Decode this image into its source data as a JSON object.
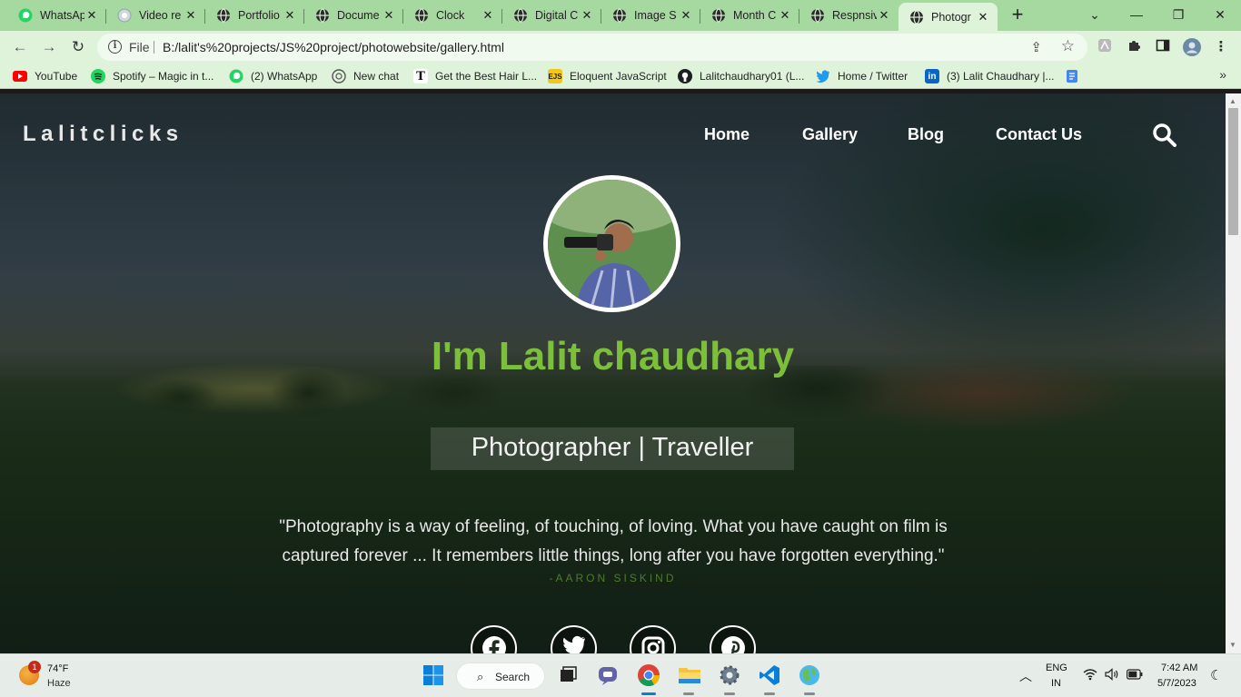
{
  "browser": {
    "tabs": [
      {
        "label": "WhatsApp",
        "favicon": "whatsapp-icon"
      },
      {
        "label": "Video re",
        "favicon": "video-icon"
      },
      {
        "label": "Portfolio",
        "favicon": "globe-icon"
      },
      {
        "label": "Docume",
        "favicon": "globe-icon"
      },
      {
        "label": "Clock",
        "favicon": "globe-icon"
      },
      {
        "label": "Digital C",
        "favicon": "globe-icon"
      },
      {
        "label": "Image S",
        "favicon": "globe-icon"
      },
      {
        "label": "Month C",
        "favicon": "globe-icon"
      },
      {
        "label": "Respnsiv",
        "favicon": "globe-icon"
      },
      {
        "label": "Photogr",
        "favicon": "globe-icon",
        "active": true
      }
    ],
    "address": {
      "scheme_label": "File",
      "url": "B:/lalit's%20projects/JS%20project/photowebsite/gallery.html"
    },
    "bookmarks": [
      {
        "label": "YouTube",
        "icon": "youtube-icon"
      },
      {
        "label": "Spotify – Magic in t...",
        "icon": "spotify-icon"
      },
      {
        "label": "(2) WhatsApp",
        "icon": "whatsapp-icon"
      },
      {
        "label": "New chat",
        "icon": "openai-icon"
      },
      {
        "label": "Get the Best Hair L...",
        "icon": "t-icon"
      },
      {
        "label": "Eloquent JavaScript",
        "icon": "ejs-icon"
      },
      {
        "label": "Lalitchaudhary01 (L...",
        "icon": "github-icon"
      },
      {
        "label": "Home / Twitter",
        "icon": "twitter-icon"
      },
      {
        "label": "(3) Lalit Chaudhary |...",
        "icon": "linkedin-icon"
      }
    ]
  },
  "site": {
    "brand": "Lalitclicks",
    "nav": [
      "Home",
      "Gallery",
      "Blog",
      "Contact Us"
    ],
    "hero": {
      "name": "I'm Lalit chaudhary",
      "roles": "Photographer | Traveller",
      "quote_line1": "\"Photography is a way of feeling, of touching, of loving. What you have caught on film is",
      "quote_line2": "captured forever ... It remembers little things, long after you have forgotten everything.\"",
      "quote_author": "-AARON SISKIND"
    },
    "social": [
      "facebook-icon",
      "twitter-icon",
      "instagram-icon",
      "pinterest-icon"
    ],
    "colors": {
      "accent": "#7cbf3a",
      "author": "#4f7a30"
    }
  },
  "taskbar": {
    "weather": {
      "temp": "74°F",
      "desc": "Haze",
      "badge": "1"
    },
    "search_label": "Search",
    "lang_line1": "ENG",
    "lang_line2": "IN",
    "time": "7:42 AM",
    "date": "5/7/2023"
  }
}
